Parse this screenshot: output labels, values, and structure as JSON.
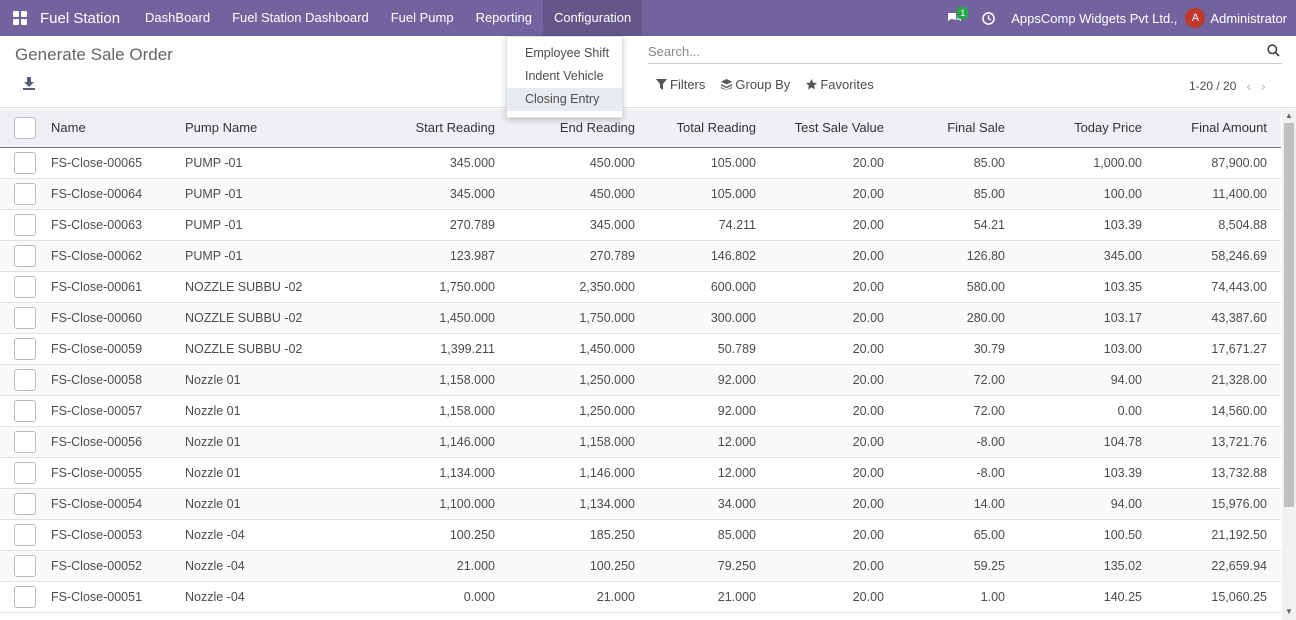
{
  "navbar": {
    "brand": "Fuel Station",
    "menu": [
      "DashBoard",
      "Fuel Station Dashboard",
      "Fuel Pump",
      "Reporting",
      "Configuration"
    ],
    "chat_count": "1",
    "company": "AppsComp Widgets Pvt Ltd.,",
    "avatar_letter": "A",
    "user": "Administrator"
  },
  "dropdown": {
    "items": [
      "Employee Shift",
      "Indent Vehicle",
      "Closing Entry"
    ]
  },
  "control_panel": {
    "title": "Generate Sale Order",
    "search_placeholder": "Search...",
    "filters_label": "Filters",
    "groupby_label": "Group By",
    "favorites_label": "Favorites",
    "pager": "1-20 / 20"
  },
  "table": {
    "headers": [
      "Name",
      "Pump Name",
      "Start Reading",
      "End Reading",
      "Total Reading",
      "Test Sale Value",
      "Final Sale",
      "Today Price",
      "Final Amount"
    ],
    "rows": [
      [
        "FS-Close-00065",
        "PUMP -01",
        "345.000",
        "450.000",
        "105.000",
        "20.00",
        "85.00",
        "1,000.00",
        "87,900.00"
      ],
      [
        "FS-Close-00064",
        "PUMP -01",
        "345.000",
        "450.000",
        "105.000",
        "20.00",
        "85.00",
        "100.00",
        "11,400.00"
      ],
      [
        "FS-Close-00063",
        "PUMP -01",
        "270.789",
        "345.000",
        "74.211",
        "20.00",
        "54.21",
        "103.39",
        "8,504.88"
      ],
      [
        "FS-Close-00062",
        "PUMP -01",
        "123.987",
        "270.789",
        "146.802",
        "20.00",
        "126.80",
        "345.00",
        "58,246.69"
      ],
      [
        "FS-Close-00061",
        "NOZZLE SUBBU -02",
        "1,750.000",
        "2,350.000",
        "600.000",
        "20.00",
        "580.00",
        "103.35",
        "74,443.00"
      ],
      [
        "FS-Close-00060",
        "NOZZLE SUBBU -02",
        "1,450.000",
        "1,750.000",
        "300.000",
        "20.00",
        "280.00",
        "103.17",
        "43,387.60"
      ],
      [
        "FS-Close-00059",
        "NOZZLE SUBBU -02",
        "1,399.211",
        "1,450.000",
        "50.789",
        "20.00",
        "30.79",
        "103.00",
        "17,671.27"
      ],
      [
        "FS-Close-00058",
        "Nozzle 01",
        "1,158.000",
        "1,250.000",
        "92.000",
        "20.00",
        "72.00",
        "94.00",
        "21,328.00"
      ],
      [
        "FS-Close-00057",
        "Nozzle 01",
        "1,158.000",
        "1,250.000",
        "92.000",
        "20.00",
        "72.00",
        "0.00",
        "14,560.00"
      ],
      [
        "FS-Close-00056",
        "Nozzle 01",
        "1,146.000",
        "1,158.000",
        "12.000",
        "20.00",
        "-8.00",
        "104.78",
        "13,721.76"
      ],
      [
        "FS-Close-00055",
        "Nozzle 01",
        "1,134.000",
        "1,146.000",
        "12.000",
        "20.00",
        "-8.00",
        "103.39",
        "13,732.88"
      ],
      [
        "FS-Close-00054",
        "Nozzle 01",
        "1,100.000",
        "1,134.000",
        "34.000",
        "20.00",
        "14.00",
        "94.00",
        "15,976.00"
      ],
      [
        "FS-Close-00053",
        "Nozzle -04",
        "100.250",
        "185.250",
        "85.000",
        "20.00",
        "65.00",
        "100.50",
        "21,192.50"
      ],
      [
        "FS-Close-00052",
        "Nozzle -04",
        "21.000",
        "100.250",
        "79.250",
        "20.00",
        "59.25",
        "135.02",
        "22,659.94"
      ],
      [
        "FS-Close-00051",
        "Nozzle -04",
        "0.000",
        "21.000",
        "21.000",
        "20.00",
        "1.00",
        "140.25",
        "15,060.25"
      ]
    ]
  },
  "colors": {
    "navbar": "#71639e",
    "badge": "#28a745",
    "avatar": "#c0392b"
  }
}
